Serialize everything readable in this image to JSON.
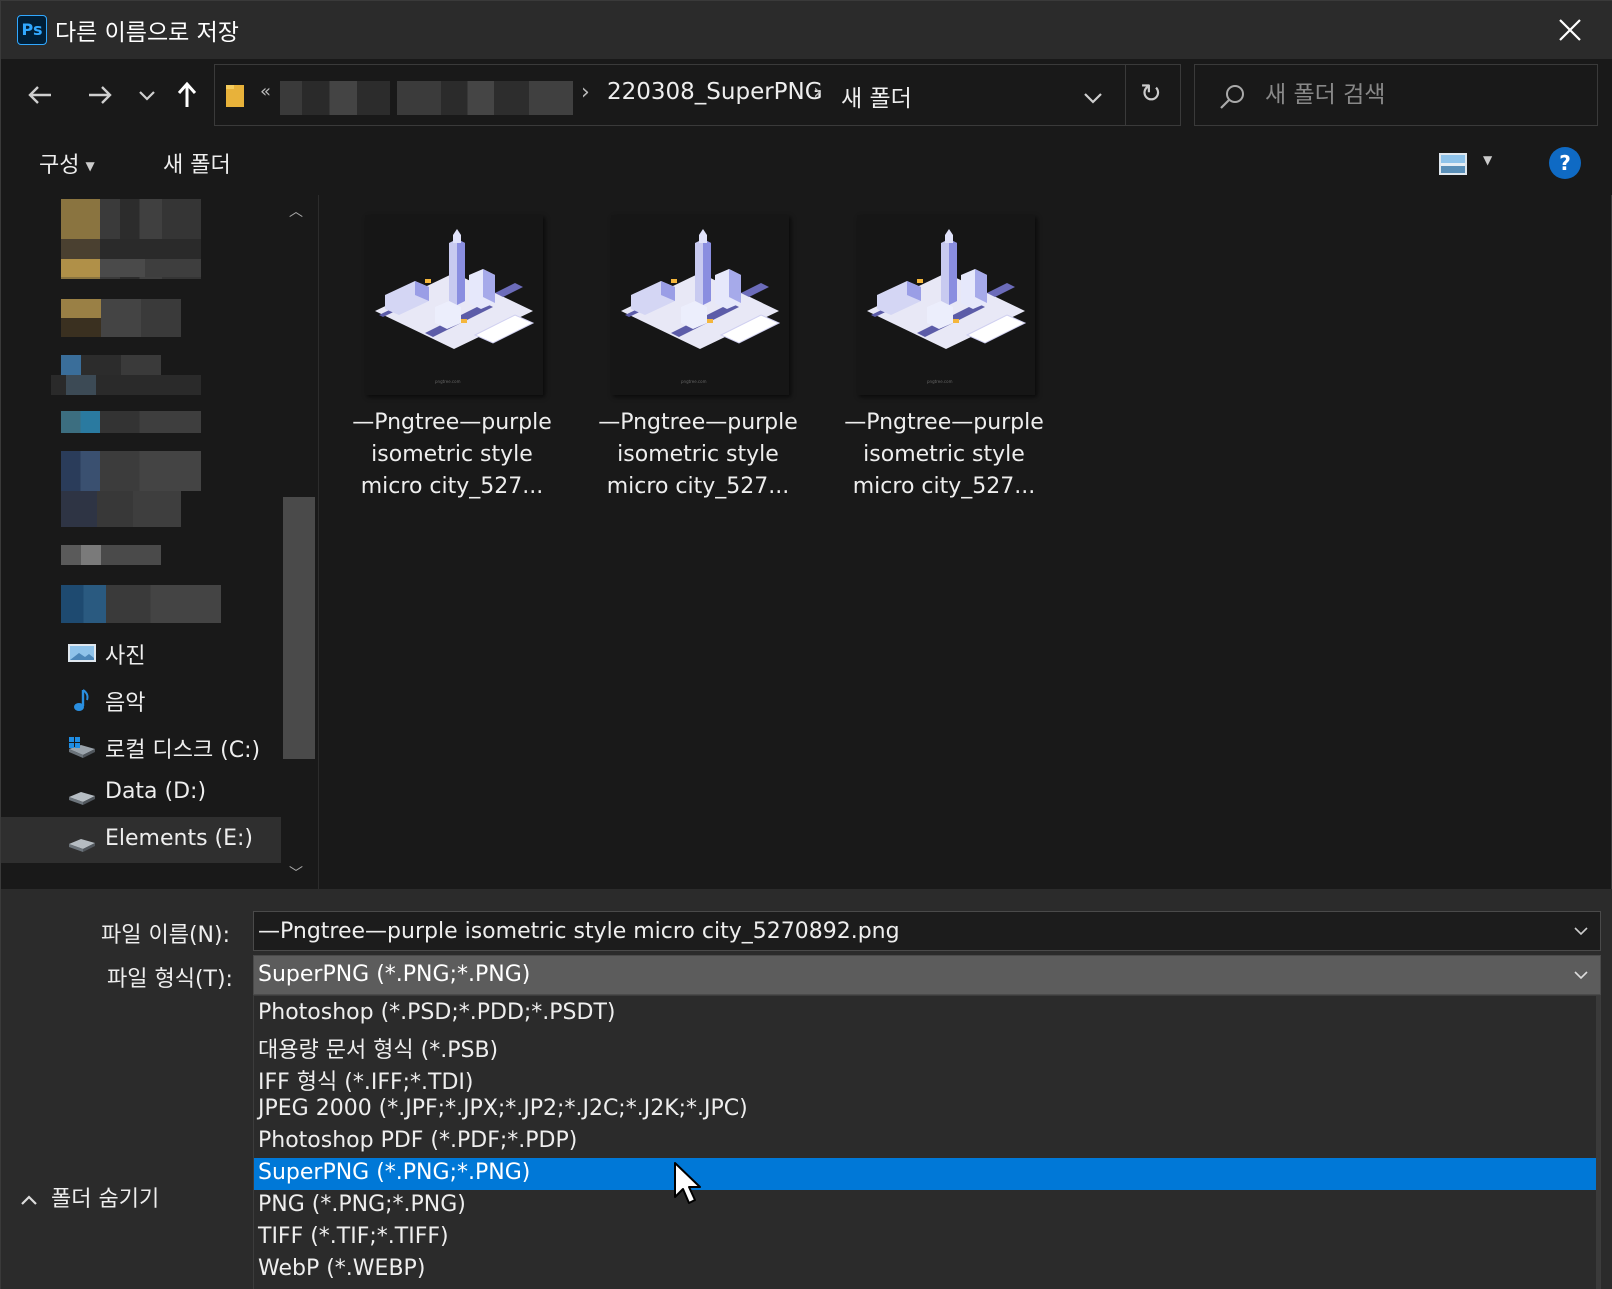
{
  "titlebar": {
    "app_icon": "photoshop-icon",
    "app_icon_text": "Ps",
    "title": "다른 이름으로 저장",
    "close_icon": "close-icon"
  },
  "navbar": {
    "address_overflow": "«",
    "breadcrumbs": [
      "220308_SuperPNG",
      "새 폴더"
    ],
    "search_placeholder": "새 폴더 검색"
  },
  "toolbar": {
    "organize_label": "구성",
    "new_folder_label": "새 폴더",
    "help_label": "?"
  },
  "sidebar": {
    "items": [
      {
        "label": "사진",
        "icon": "pictures-icon"
      },
      {
        "label": "음악",
        "icon": "music-icon"
      },
      {
        "label": "로컬 디스크 (C:)",
        "icon": "windows-drive-icon"
      },
      {
        "label": "Data (D:)",
        "icon": "drive-icon"
      },
      {
        "label": "Elements (E:)",
        "icon": "drive-icon"
      }
    ]
  },
  "files": [
    {
      "name": "—Pngtree—purple isometric style micro city_527..."
    },
    {
      "name": "—Pngtree—purple isometric style micro city_527..."
    },
    {
      "name": "—Pngtree—purple isometric style micro city_527..."
    }
  ],
  "bottom": {
    "filename_label": "파일 이름(N):",
    "filename_value": "—Pngtree—purple isometric style micro city_5270892.png",
    "filetype_label": "파일 형식(T):",
    "filetype_value": "SuperPNG (*.PNG;*.PNG)",
    "filetype_options": [
      "Photoshop (*.PSD;*.PDD;*.PSDT)",
      "대용량 문서 형식 (*.PSB)",
      "IFF 형식 (*.IFF;*.TDI)",
      "JPEG 2000 (*.JPF;*.JPX;*.JP2;*.J2C;*.J2K;*.JPC)",
      "Photoshop PDF (*.PDF;*.PDP)",
      "SuperPNG (*.PNG;*.PNG)",
      "PNG (*.PNG;*.PNG)",
      "TIFF (*.TIF;*.TIFF)",
      "WebP (*.WEBP)"
    ],
    "selected_option": "SuperPNG (*.PNG;*.PNG)",
    "hide_folders_label": "폴더 숨기기"
  },
  "colors": {
    "accent": "#0078d7",
    "background": "#191919",
    "panel": "#2b2b2b",
    "help": "#0f6ac4"
  }
}
